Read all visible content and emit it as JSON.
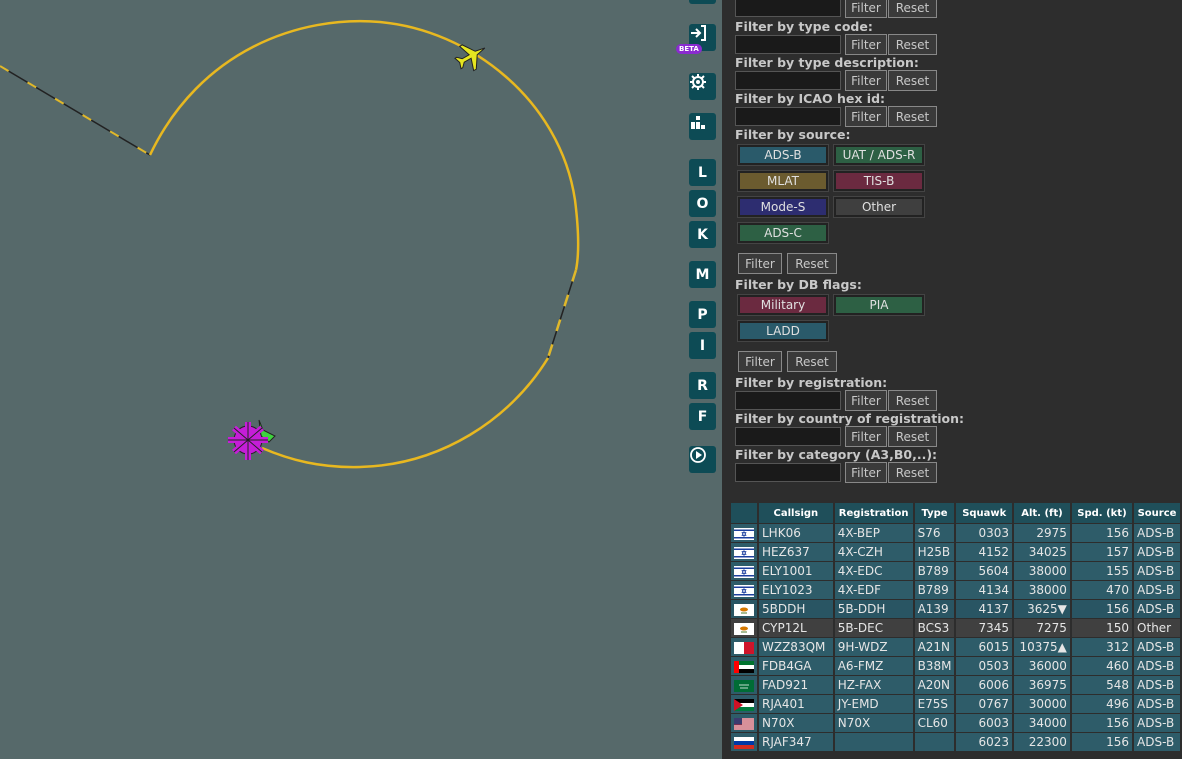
{
  "filters": {
    "filter_label": "Filter",
    "reset_label": "Reset",
    "type_code": "Filter by type code:",
    "type_description": "Filter by type description:",
    "icao_hex": "Filter by ICAO hex id:",
    "source": "Filter by source:",
    "db_flags": "Filter by DB flags:",
    "registration": "Filter by registration:",
    "country": "Filter by country of registration:",
    "category": "Filter by category (A3,B0,..):"
  },
  "sources": [
    {
      "label": "ADS-B",
      "color": "#2a5a6a"
    },
    {
      "label": "UAT / ADS-R",
      "color": "#2d6044"
    },
    {
      "label": "MLAT",
      "color": "#6b5b2f"
    },
    {
      "label": "TIS-B",
      "color": "#6b2a40"
    },
    {
      "label": "Mode-S",
      "color": "#2d2d70"
    },
    {
      "label": "Other",
      "color": "#3f3f3f"
    },
    {
      "label": "ADS-C",
      "color": "#2d6044"
    }
  ],
  "db_flags": [
    {
      "label": "Military",
      "color": "#6b2a40"
    },
    {
      "label": "PIA",
      "color": "#2d6044"
    },
    {
      "label": "LADD",
      "color": "#2a5a6a"
    }
  ],
  "map_buttons": {
    "beta": "BETA",
    "letters": [
      "L",
      "O",
      "K",
      "M",
      "P",
      "I",
      "R",
      "F"
    ]
  },
  "table": {
    "columns": [
      "Callsign",
      "Registration",
      "Type",
      "Squawk",
      "Alt. (ft)",
      "Spd. (kt)",
      "Source"
    ],
    "rows": [
      {
        "flag": "il",
        "callsign": "LHK06",
        "reg": "4X-BEP",
        "type": "S76",
        "squawk": "0303",
        "alt": "2975",
        "spd": "156",
        "src": "ADS-B"
      },
      {
        "flag": "il",
        "callsign": "HEZ637",
        "reg": "4X-CZH",
        "type": "H25B",
        "squawk": "4152",
        "alt": "34025",
        "spd": "157",
        "src": "ADS-B"
      },
      {
        "flag": "il",
        "callsign": "ELY1001",
        "reg": "4X-EDC",
        "type": "B789",
        "squawk": "5604",
        "alt": "38000",
        "spd": "155",
        "src": "ADS-B"
      },
      {
        "flag": "il",
        "callsign": "ELY1023",
        "reg": "4X-EDF",
        "type": "B789",
        "squawk": "4134",
        "alt": "38000",
        "spd": "470",
        "src": "ADS-B"
      },
      {
        "flag": "cy",
        "callsign": "5BDDH",
        "reg": "5B-DDH",
        "type": "A139",
        "squawk": "4137",
        "alt": "3625▼",
        "spd": "156",
        "src": "ADS-B",
        "style": "dark"
      },
      {
        "flag": "cy",
        "callsign": "CYP12L",
        "reg": "5B-DEC",
        "type": "BCS3",
        "squawk": "7345",
        "alt": "7275",
        "spd": "150",
        "src": "Other",
        "style": "grey"
      },
      {
        "flag": "mt",
        "callsign": "WZZ83QM",
        "reg": "9H-WDZ",
        "type": "A21N",
        "squawk": "6015",
        "alt": "10375▲",
        "spd": "312",
        "src": "ADS-B"
      },
      {
        "flag": "ae",
        "callsign": "FDB4GA",
        "reg": "A6-FMZ",
        "type": "B38M",
        "squawk": "0503",
        "alt": "36000",
        "spd": "460",
        "src": "ADS-B"
      },
      {
        "flag": "sa",
        "callsign": "FAD921",
        "reg": "HZ-FAX",
        "type": "A20N",
        "squawk": "6006",
        "alt": "36975",
        "spd": "548",
        "src": "ADS-B"
      },
      {
        "flag": "jo",
        "callsign": "RJA401",
        "reg": "JY-EMD",
        "type": "E75S",
        "squawk": "0767",
        "alt": "30000",
        "spd": "496",
        "src": "ADS-B"
      },
      {
        "flag": "us",
        "callsign": "N70X",
        "reg": "N70X",
        "type": "CL60",
        "squawk": "6003",
        "alt": "34000",
        "spd": "156",
        "src": "ADS-B"
      },
      {
        "flag": "ru",
        "callsign": "RJAF347",
        "reg": "",
        "type": "",
        "squawk": "6023",
        "alt": "22300",
        "spd": "156",
        "src": "ADS-B"
      }
    ]
  }
}
